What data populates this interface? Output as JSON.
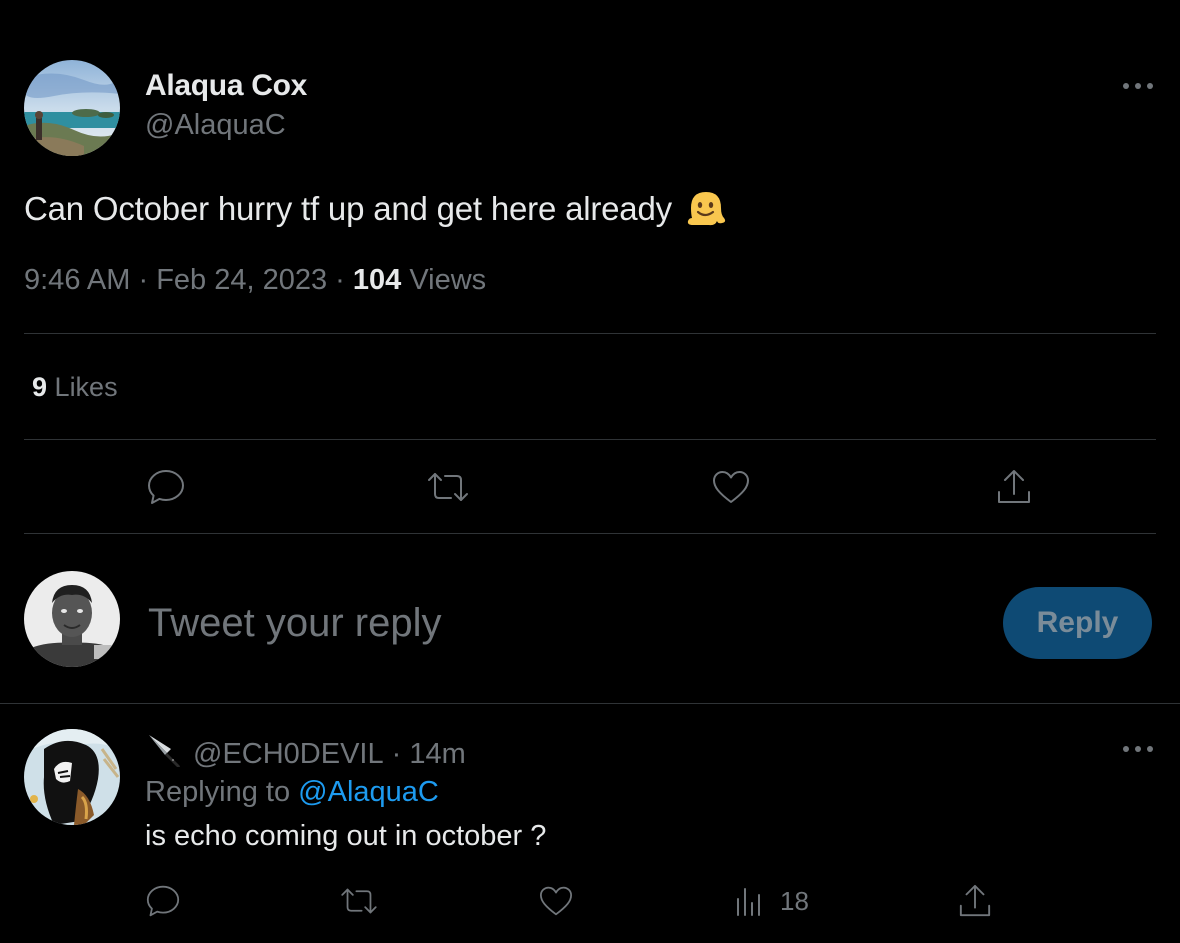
{
  "tweet": {
    "author_name": "Alaqua Cox",
    "author_handle": "@AlaquaC",
    "text": "Can October hurry tf up and get here already",
    "emoji": "melting-face",
    "time": "9:46 AM",
    "date": "Feb 24, 2023",
    "views_count": "104",
    "views_label": "Views",
    "likes_count": "9",
    "likes_label": "Likes"
  },
  "composer": {
    "placeholder": "Tweet your reply",
    "reply_label": "Reply"
  },
  "reply": {
    "handle": "@ECH0DEVIL",
    "time": "14m",
    "replying_prefix": "Replying to",
    "replying_to": "@AlaquaC",
    "text": "is echo coming out in october ?",
    "views_count": "18"
  },
  "colors": {
    "background": "#000000",
    "primary_text": "#e7e9ea",
    "secondary_text": "#71767b",
    "accent": "#1d9bf0",
    "reply_button_disabled": "#0e4a74",
    "divider": "#2f3336"
  }
}
